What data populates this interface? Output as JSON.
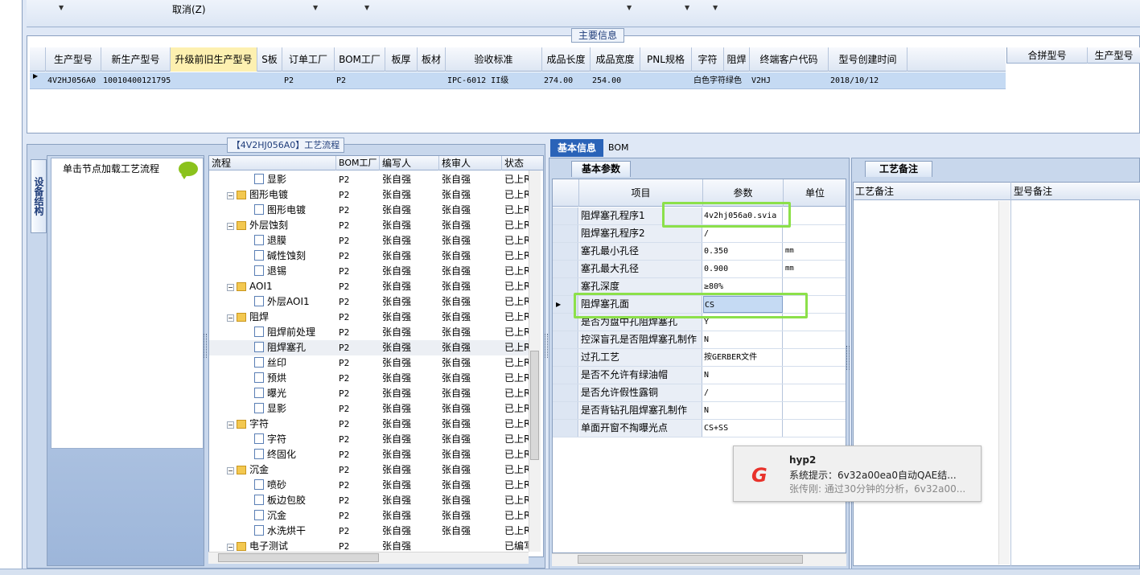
{
  "toolbar": {
    "cancel": "取消(Z)"
  },
  "main_info": {
    "title": "主要信息",
    "headers": [
      "生产型号",
      "新生产型号",
      "升级前旧生产型号",
      "S板",
      "订单工厂",
      "BOM工厂",
      "板厚",
      "板材",
      "验收标准",
      "成品长度",
      "成品宽度",
      "PNL规格",
      "字符",
      "阻焊",
      "终端客户代码",
      "型号创建时间"
    ],
    "row": [
      "4V2HJ056A0",
      "10010400121795",
      "",
      "",
      "P2",
      "P2",
      "",
      "",
      "IPC-6012 II级",
      "274.00",
      "254.00",
      "",
      "白色字符",
      "绿色",
      "V2HJ",
      "2018/10/12"
    ],
    "merge_headers": [
      "合拼型号",
      "生产型号"
    ]
  },
  "process": {
    "title": "【4V2HJ056A0】工艺流程",
    "vertical_tab": "设备结构",
    "node_caption": "单击节点加载工艺流程",
    "columns": [
      "流程",
      "BOM工厂",
      "编写人",
      "核审人",
      "状态"
    ],
    "rows": [
      {
        "name": "显影",
        "level": 2,
        "type": "file",
        "factory": "P2",
        "writer": "张自强",
        "reviewer": "张自强",
        "status": "已上R"
      },
      {
        "name": "图形电镀",
        "level": 1,
        "type": "folder",
        "factory": "P2",
        "writer": "张自强",
        "reviewer": "张自强",
        "status": "已上R"
      },
      {
        "name": "图形电镀",
        "level": 2,
        "type": "file",
        "factory": "P2",
        "writer": "张自强",
        "reviewer": "张自强",
        "status": "已上R"
      },
      {
        "name": "外层蚀刻",
        "level": 1,
        "type": "folder",
        "factory": "P2",
        "writer": "张自强",
        "reviewer": "张自强",
        "status": "已上R"
      },
      {
        "name": "退膜",
        "level": 2,
        "type": "file",
        "factory": "P2",
        "writer": "张自强",
        "reviewer": "张自强",
        "status": "已上R"
      },
      {
        "name": "碱性蚀刻",
        "level": 2,
        "type": "file",
        "factory": "P2",
        "writer": "张自强",
        "reviewer": "张自强",
        "status": "已上R"
      },
      {
        "name": "退锡",
        "level": 2,
        "type": "file",
        "factory": "P2",
        "writer": "张自强",
        "reviewer": "张自强",
        "status": "已上R"
      },
      {
        "name": "AOI1",
        "level": 1,
        "type": "folder",
        "factory": "P2",
        "writer": "张自强",
        "reviewer": "张自强",
        "status": "已上R"
      },
      {
        "name": "外层AOI1",
        "level": 2,
        "type": "file",
        "factory": "P2",
        "writer": "张自强",
        "reviewer": "张自强",
        "status": "已上R"
      },
      {
        "name": "阻焊",
        "level": 1,
        "type": "folder",
        "factory": "P2",
        "writer": "张自强",
        "reviewer": "张自强",
        "status": "已上R"
      },
      {
        "name": "阻焊前处理",
        "level": 2,
        "type": "file",
        "factory": "P2",
        "writer": "张自强",
        "reviewer": "张自强",
        "status": "已上R"
      },
      {
        "name": "阻焊塞孔",
        "level": 2,
        "type": "file",
        "factory": "P2",
        "writer": "张自强",
        "reviewer": "张自强",
        "status": "已上R",
        "selected": true
      },
      {
        "name": "丝印",
        "level": 2,
        "type": "file",
        "factory": "P2",
        "writer": "张自强",
        "reviewer": "张自强",
        "status": "已上R"
      },
      {
        "name": "预烘",
        "level": 2,
        "type": "file",
        "factory": "P2",
        "writer": "张自强",
        "reviewer": "张自强",
        "status": "已上R"
      },
      {
        "name": "曝光",
        "level": 2,
        "type": "file",
        "factory": "P2",
        "writer": "张自强",
        "reviewer": "张自强",
        "status": "已上R"
      },
      {
        "name": "显影",
        "level": 2,
        "type": "file",
        "factory": "P2",
        "writer": "张自强",
        "reviewer": "张自强",
        "status": "已上R"
      },
      {
        "name": "字符",
        "level": 1,
        "type": "folder",
        "factory": "P2",
        "writer": "张自强",
        "reviewer": "张自强",
        "status": "已上R"
      },
      {
        "name": "字符",
        "level": 2,
        "type": "file",
        "factory": "P2",
        "writer": "张自强",
        "reviewer": "张自强",
        "status": "已上R"
      },
      {
        "name": "终固化",
        "level": 2,
        "type": "file",
        "factory": "P2",
        "writer": "张自强",
        "reviewer": "张自强",
        "status": "已上R"
      },
      {
        "name": "沉金",
        "level": 1,
        "type": "folder",
        "factory": "P2",
        "writer": "张自强",
        "reviewer": "张自强",
        "status": "已上R"
      },
      {
        "name": "喷砂",
        "level": 2,
        "type": "file",
        "factory": "P2",
        "writer": "张自强",
        "reviewer": "张自强",
        "status": "已上R"
      },
      {
        "name": "板边包胶",
        "level": 2,
        "type": "file",
        "factory": "P2",
        "writer": "张自强",
        "reviewer": "张自强",
        "status": "已上R"
      },
      {
        "name": "沉金",
        "level": 2,
        "type": "file",
        "factory": "P2",
        "writer": "张自强",
        "reviewer": "张自强",
        "status": "已上R"
      },
      {
        "name": "水洗烘干",
        "level": 2,
        "type": "file",
        "factory": "P2",
        "writer": "张自强",
        "reviewer": "张自强",
        "status": "已上R"
      },
      {
        "name": "电子测试",
        "level": 1,
        "type": "folder",
        "factory": "P2",
        "writer": "张自强",
        "reviewer": "",
        "status": "已编写"
      }
    ]
  },
  "basic": {
    "tab_basic": "基本信息",
    "tab_bom": "BOM",
    "params_tab": "基本参数",
    "headers": [
      "项目",
      "参数",
      "单位"
    ],
    "rows": [
      {
        "name": "阻焊塞孔程序1",
        "value": "4v2hj056a0.svia",
        "unit": ""
      },
      {
        "name": "阻焊塞孔程序2",
        "value": "/",
        "unit": ""
      },
      {
        "name": "塞孔最小孔径",
        "value": "0.350",
        "unit": "mm"
      },
      {
        "name": "塞孔最大孔径",
        "value": "0.900",
        "unit": "mm"
      },
      {
        "name": "塞孔深度",
        "value": "≥80%",
        "unit": ""
      },
      {
        "name": "阻焊塞孔面",
        "value": "CS",
        "unit": "",
        "current": true
      },
      {
        "name": "是否为盘中孔阻焊塞孔",
        "value": "Y",
        "unit": ""
      },
      {
        "name": "控深盲孔是否阻焊塞孔制作",
        "value": "N",
        "unit": ""
      },
      {
        "name": "过孔工艺",
        "value": "按GERBER文件",
        "unit": ""
      },
      {
        "name": "是否不允许有绿油帽",
        "value": "N",
        "unit": ""
      },
      {
        "name": "是否允许假性露铜",
        "value": "/",
        "unit": ""
      },
      {
        "name": "是否背钻孔阻焊塞孔制作",
        "value": "N",
        "unit": ""
      },
      {
        "name": "单面开窗不掏曝光点",
        "value": "CS+SS",
        "unit": ""
      }
    ]
  },
  "remark": {
    "tab": "工艺备注",
    "headers": [
      "工艺备注",
      "型号备注"
    ]
  },
  "toast": {
    "logo": "G",
    "title": "hyp2",
    "line1": "系统提示：6v32a00ea0自动QAE结...",
    "line2": "张传刚: 通过30分钟的分析，6v32a00..."
  },
  "colors": {
    "selection": "#c5daf3",
    "highlight_box": "#8ce04a",
    "active_tab": "#2a63b8",
    "toast_logo": "#e8322b"
  }
}
